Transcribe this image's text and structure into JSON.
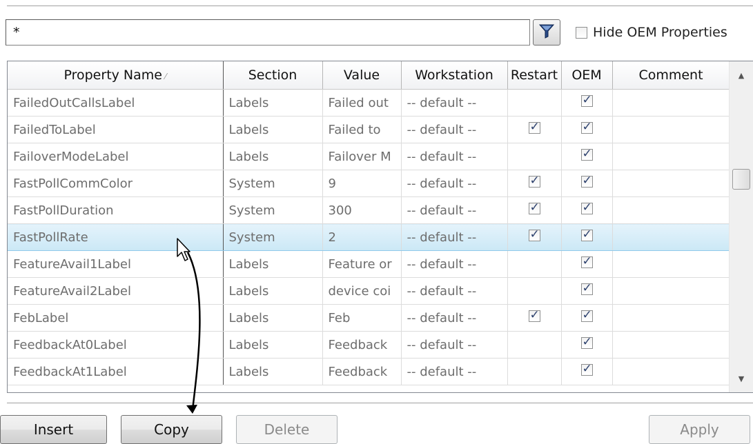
{
  "filter": {
    "value": "*"
  },
  "hide_oem": {
    "label": "Hide OEM Properties",
    "checked": false
  },
  "columns": [
    "Property Name",
    "Section",
    "Value",
    "Workstation",
    "Restart",
    "OEM",
    "Comment"
  ],
  "rows": [
    {
      "name": "FailedOutCallsLabel",
      "section": "Labels",
      "value": "Failed out",
      "workstation": "-- default --",
      "restart": false,
      "oem": true,
      "comment": ""
    },
    {
      "name": "FailedToLabel",
      "section": "Labels",
      "value": "Failed to",
      "workstation": "-- default --",
      "restart": true,
      "oem": true,
      "comment": ""
    },
    {
      "name": "FailoverModeLabel",
      "section": "Labels",
      "value": "Failover M",
      "workstation": "-- default --",
      "restart": false,
      "oem": true,
      "comment": ""
    },
    {
      "name": "FastPollCommColor",
      "section": "System",
      "value": "9",
      "workstation": "-- default --",
      "restart": true,
      "oem": true,
      "comment": ""
    },
    {
      "name": "FastPollDuration",
      "section": "System",
      "value": "300",
      "workstation": "-- default --",
      "restart": true,
      "oem": true,
      "comment": ""
    },
    {
      "name": "FastPollRate",
      "section": "System",
      "value": "2",
      "workstation": "-- default --",
      "restart": true,
      "oem": true,
      "comment": "",
      "selected": true
    },
    {
      "name": "FeatureAvail1Label",
      "section": "Labels",
      "value": "Feature or",
      "workstation": "-- default --",
      "restart": false,
      "oem": true,
      "comment": ""
    },
    {
      "name": "FeatureAvail2Label",
      "section": "Labels",
      "value": "device coi",
      "workstation": "-- default --",
      "restart": false,
      "oem": true,
      "comment": ""
    },
    {
      "name": "FebLabel",
      "section": "Labels",
      "value": "Feb",
      "workstation": "-- default --",
      "restart": true,
      "oem": true,
      "comment": ""
    },
    {
      "name": "FeedbackAt0Label",
      "section": "Labels",
      "value": "Feedback",
      "workstation": "-- default --",
      "restart": false,
      "oem": true,
      "comment": ""
    },
    {
      "name": "FeedbackAt1Label",
      "section": "Labels",
      "value": "Feedback",
      "workstation": "-- default --",
      "restart": false,
      "oem": true,
      "comment": ""
    }
  ],
  "buttons": {
    "insert": "Insert",
    "copy": "Copy",
    "delete": "Delete",
    "apply": "Apply"
  },
  "icons": {
    "filter": "funnel-icon",
    "sort": "sort-indicator-icon"
  },
  "colors": {
    "selection": "#cbe8f6",
    "funnel": "#2a4a86"
  }
}
